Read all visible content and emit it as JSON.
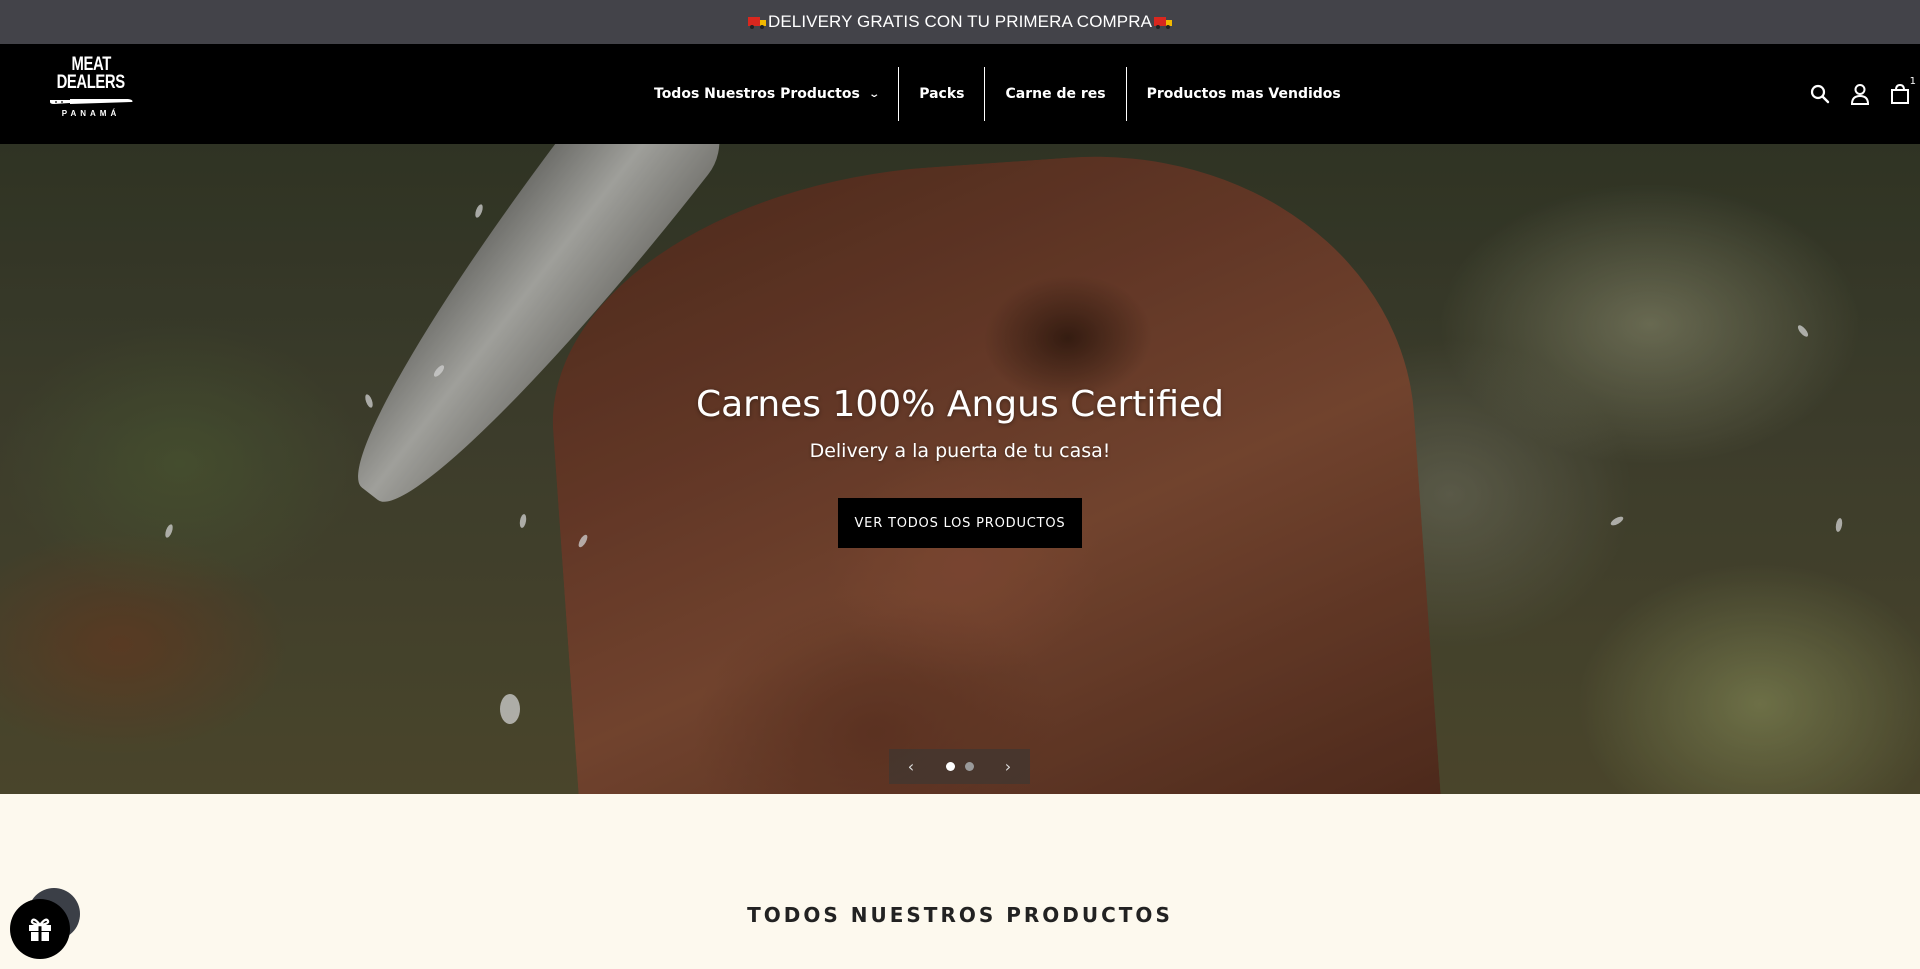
{
  "announcement": {
    "text": "DELIVERY GRATIS CON TU PRIMERA COMPRA",
    "icon": "delivery-truck-emoji"
  },
  "header": {
    "logo": {
      "line1": "MEAT",
      "line2": "DEALERS",
      "line3": "PANAMÁ"
    },
    "nav": [
      {
        "label": "Todos Nuestros Productos",
        "has_dropdown": true
      },
      {
        "label": "Packs"
      },
      {
        "label": "Carne de res"
      },
      {
        "label": "Productos mas Vendidos"
      }
    ],
    "icons": [
      "search-icon",
      "account-icon",
      "cart-icon"
    ],
    "cart_count": "1"
  },
  "hero": {
    "title": "Carnes 100% Angus Certified",
    "subtitle": "Delivery a la puerta de tu casa!",
    "button_label": "VER TODOS LOS PRODUCTOS",
    "slides_total": 2,
    "active_slide": 1,
    "prev_icon": "‹",
    "next_icon": "›"
  },
  "section": {
    "title": "TODOS NUESTROS PRODUCTOS"
  },
  "colors": {
    "announcement_bg": "#434349",
    "header_bg": "#000000",
    "page_bg": "#fdf9ee",
    "button_bg": "#000000"
  }
}
